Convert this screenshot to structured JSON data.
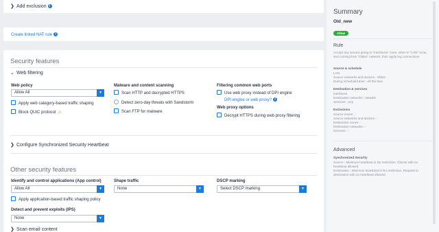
{
  "exclusion": {
    "add_label": "Add exclusion"
  },
  "nat": {
    "link_label": "Create linked NAT rule"
  },
  "security": {
    "title": "Security features",
    "web_filtering_label": "Web filtering",
    "web_policy_label": "Web policy",
    "web_policy_value": "Allow All",
    "apply_shaping_label": "Apply web category-based traffic shaping",
    "block_quic_label": "Block QUIC protocol",
    "malware_title": "Malware and content scanning",
    "scan_http_label": "Scan HTTP and decrypted HTTPS",
    "zero_day_label": "Detect zero-day threats with Sandstorm",
    "scan_ftp_label": "Scan FTP for malware",
    "filter_ports_title": "Filtering common web ports",
    "use_proxy_label": "Use web proxy instead of DPI engine",
    "dpi_link_label": "DPI engine or web proxy?",
    "proxy_options_title": "Web proxy options",
    "decrypt_https_label": "Decrypt HTTPS during web proxy filtering"
  },
  "heartbeat": {
    "label": "Configure Synchronized Security Heartbeat"
  },
  "other": {
    "title": "Other security features",
    "app_control_label": "Identify and control applications (App control)",
    "app_control_value": "Allow All",
    "shape_traffic_label": "Shape traffic",
    "shape_traffic_value": "None",
    "dscp_label": "DSCP marking",
    "dscp_value": "Select DSCP marking",
    "app_shaping_label": "Apply application-based traffic shaping policy",
    "ips_label": "Detect and prevent exploits (IPS)",
    "ips_value": "None",
    "scan_email_label": "Scan email content"
  },
  "summary": {
    "title": "Summary",
    "rule_name": "Old_new",
    "action_badge": "Allow",
    "rule_title": "Rule",
    "rule_desc": "Accept any service going to \"Interfaces\" zone, when in \"LAN\" zone, and coming from \"Olden\" network, then apply log connections",
    "source_schedule_title": "Source & schedule",
    "source_schedule_lines": [
      "LAN",
      "Source networks and devices : Olden",
      "During scheduled time : All the time"
    ],
    "dest_services_title": "Destination & services",
    "dest_services_lines": [
      "Interfaces",
      "Destination networks : Newtek",
      "Services : Any"
    ],
    "exclusions_title": "Exclusions",
    "exclusions_lines": [
      "Source zones : -",
      "Source networks and devices : -",
      "Destination zones : -",
      "Destination networks : -",
      "Services : -"
    ],
    "advanced_title": "Advanced",
    "sync_title": "Synchronized Security",
    "sync_lines": [
      "Source : Minimum heartbeat is No restriction. Clients with no heartbeat allowed",
      "Destination : Minimum heartbeat is No restriction. Request to destination with no heartbeat allowed"
    ]
  },
  "colors": {
    "accent": "#1f7ad6",
    "allow": "#2eaa3c",
    "warning": "#f39200"
  }
}
